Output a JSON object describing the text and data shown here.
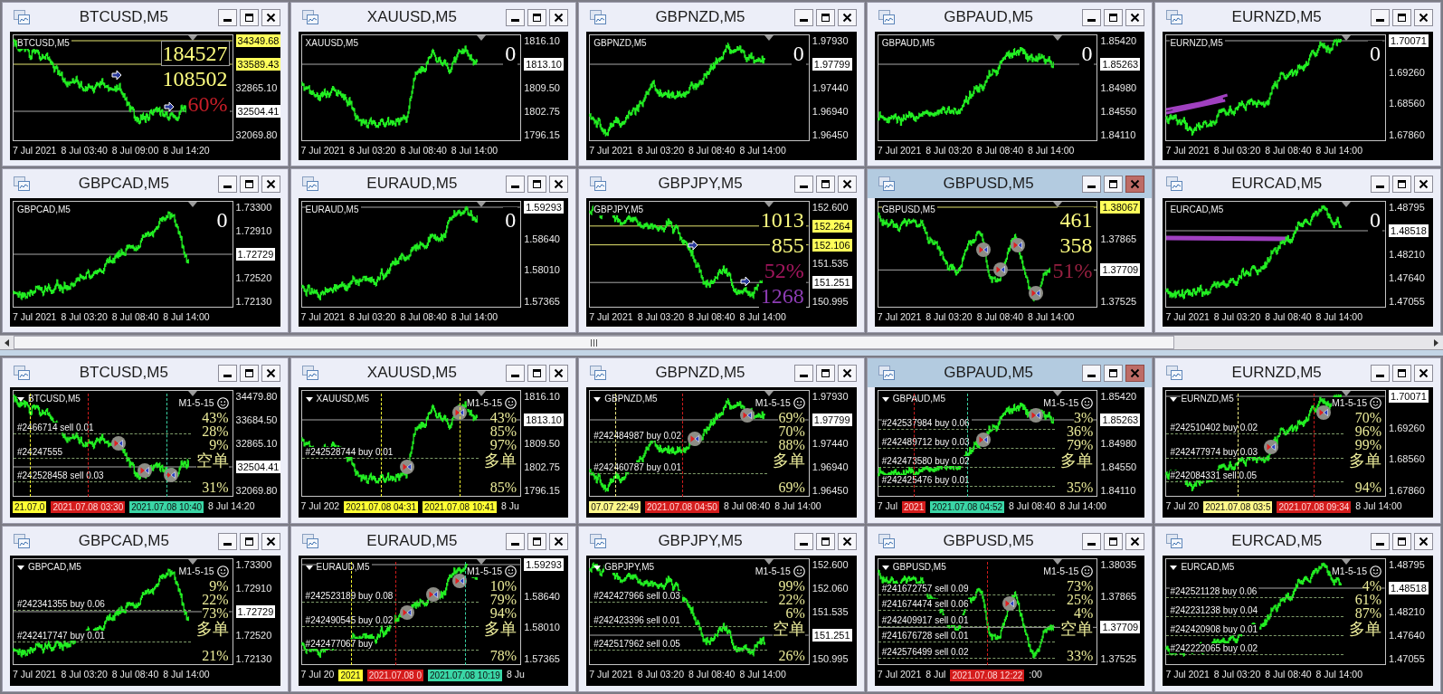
{
  "top_panel": {
    "windows": [
      {
        "title": "BTCUSD,M5",
        "selected": false,
        "chart": {
          "symbol": "BTCUSD,M5",
          "overlays": [
            {
              "text": "184527",
              "color": "#ffff80",
              "selected": true
            },
            {
              "text": "108502",
              "color": "#ffff80",
              "selected": false
            },
            {
              "text": "60%",
              "color": "#c81e28",
              "selected": false
            }
          ],
          "markers": [
            {
              "kind": "arrow"
            },
            {
              "kind": "arrow"
            }
          ],
          "price_axis": [
            {
              "text": "34349.68",
              "kind": "level"
            },
            {
              "text": "33589.43",
              "kind": "level"
            },
            {
              "text": "32865.10",
              "kind": "tick"
            },
            {
              "text": "32504.41",
              "kind": "bid"
            },
            {
              "text": "32069.80",
              "kind": "tick"
            }
          ],
          "time_axis": [
            {
              "text": "7 Jul 2021",
              "kind": "label"
            },
            {
              "text": "8 Jul 03:40",
              "kind": "label"
            },
            {
              "text": "8 Jul 09:00",
              "kind": "label"
            },
            {
              "text": "8 Jul 14:20",
              "kind": "label"
            }
          ]
        }
      },
      {
        "title": "XAUUSD,M5",
        "selected": false,
        "chart": {
          "symbol": "XAUUSD,M5",
          "overlays": [
            {
              "text": "0",
              "color": "#ffffff",
              "selected": false
            }
          ],
          "price_axis": [
            {
              "text": "1816.10",
              "kind": "tick"
            },
            {
              "text": "1813.10",
              "kind": "bid"
            },
            {
              "text": "1809.50",
              "kind": "tick"
            },
            {
              "text": "1802.75",
              "kind": "tick"
            },
            {
              "text": "1796.15",
              "kind": "tick"
            }
          ],
          "time_axis": [
            {
              "text": "7 Jul 2021",
              "kind": "label"
            },
            {
              "text": "8 Jul 03:20",
              "kind": "label"
            },
            {
              "text": "8 Jul 08:40",
              "kind": "label"
            },
            {
              "text": "8 Jul 14:00",
              "kind": "label"
            }
          ]
        }
      },
      {
        "title": "GBPNZD,M5",
        "selected": false,
        "chart": {
          "symbol": "GBPNZD,M5",
          "overlays": [
            {
              "text": "0",
              "color": "#ffffff",
              "selected": false
            }
          ],
          "price_axis": [
            {
              "text": "1.97930",
              "kind": "tick"
            },
            {
              "text": "1.97799",
              "kind": "bid"
            },
            {
              "text": "1.97440",
              "kind": "tick"
            },
            {
              "text": "1.96940",
              "kind": "tick"
            },
            {
              "text": "1.96450",
              "kind": "tick"
            }
          ],
          "time_axis": [
            {
              "text": "7 Jul 2021",
              "kind": "label"
            },
            {
              "text": "8 Jul 03:20",
              "kind": "label"
            },
            {
              "text": "8 Jul 08:40",
              "kind": "label"
            },
            {
              "text": "8 Jul 14:00",
              "kind": "label"
            }
          ]
        }
      },
      {
        "title": "GBPAUD,M5",
        "selected": false,
        "chart": {
          "symbol": "GBPAUD,M5",
          "overlays": [
            {
              "text": "0",
              "color": "#ffffff",
              "selected": false
            }
          ],
          "price_axis": [
            {
              "text": "1.85420",
              "kind": "tick"
            },
            {
              "text": "1.85263",
              "kind": "bid"
            },
            {
              "text": "1.84980",
              "kind": "tick"
            },
            {
              "text": "1.84550",
              "kind": "tick"
            },
            {
              "text": "1.84110",
              "kind": "tick"
            }
          ],
          "time_axis": [
            {
              "text": "7 Jul 2021",
              "kind": "label"
            },
            {
              "text": "8 Jul 03:20",
              "kind": "label"
            },
            {
              "text": "8 Jul 08:40",
              "kind": "label"
            },
            {
              "text": "8 Jul 14:00",
              "kind": "label"
            }
          ]
        }
      },
      {
        "title": "EURNZD,M5",
        "selected": false,
        "chart": {
          "symbol": "EURNZD,M5",
          "indicator_lines": [
            {
              "kind": "fan"
            }
          ],
          "overlays": [
            {
              "text": "0",
              "color": "#ffffff",
              "selected": false
            }
          ],
          "price_axis": [
            {
              "text": "1.70071",
              "kind": "bid"
            },
            {
              "text": "1.69260",
              "kind": "tick"
            },
            {
              "text": "1.68560",
              "kind": "tick"
            },
            {
              "text": "1.67860",
              "kind": "tick"
            }
          ],
          "time_axis": [
            {
              "text": "7 Jul 2021",
              "kind": "label"
            },
            {
              "text": "8 Jul 03:20",
              "kind": "label"
            },
            {
              "text": "8 Jul 08:40",
              "kind": "label"
            },
            {
              "text": "8 Jul 14:00",
              "kind": "label"
            }
          ]
        }
      },
      {
        "title": "GBPCAD,M5",
        "selected": false,
        "chart": {
          "symbol": "GBPCAD,M5",
          "overlays": [
            {
              "text": "0",
              "color": "#ffffff",
              "selected": false
            }
          ],
          "price_axis": [
            {
              "text": "1.73300",
              "kind": "tick"
            },
            {
              "text": "1.72910",
              "kind": "tick"
            },
            {
              "text": "1.72729",
              "kind": "bid"
            },
            {
              "text": "1.72520",
              "kind": "tick"
            },
            {
              "text": "1.72130",
              "kind": "tick"
            }
          ],
          "time_axis": [
            {
              "text": "7 Jul 2021",
              "kind": "label"
            },
            {
              "text": "8 Jul 03:20",
              "kind": "label"
            },
            {
              "text": "8 Jul 08:40",
              "kind": "label"
            },
            {
              "text": "8 Jul 14:00",
              "kind": "label"
            }
          ]
        }
      },
      {
        "title": "EURAUD,M5",
        "selected": false,
        "chart": {
          "symbol": "EURAUD,M5",
          "overlays": [
            {
              "text": "0",
              "color": "#ffffff",
              "selected": false
            }
          ],
          "price_axis": [
            {
              "text": "1.59293",
              "kind": "bid"
            },
            {
              "text": "1.58640",
              "kind": "tick"
            },
            {
              "text": "1.58010",
              "kind": "tick"
            },
            {
              "text": "1.57365",
              "kind": "tick"
            }
          ],
          "time_axis": [
            {
              "text": "7 Jul 2021",
              "kind": "label"
            },
            {
              "text": "8 Jul 03:20",
              "kind": "label"
            },
            {
              "text": "8 Jul 08:40",
              "kind": "label"
            },
            {
              "text": "8 Jul 14:00",
              "kind": "label"
            }
          ]
        }
      },
      {
        "title": "GBPJPY,M5",
        "selected": false,
        "chart": {
          "symbol": "GBPJPY,M5",
          "overlays": [
            {
              "text": "1013",
              "color": "#ffff80",
              "selected": false
            },
            {
              "text": "855",
              "color": "#ffff80",
              "selected": false
            },
            {
              "text": "52%",
              "color": "#a3165e",
              "selected": false
            },
            {
              "text": "1268",
              "color": "#8d3cb4",
              "selected": false
            }
          ],
          "markers": [
            {
              "kind": "arrow"
            },
            {
              "kind": "arrow"
            }
          ],
          "price_axis": [
            {
              "text": "152.600",
              "kind": "tick"
            },
            {
              "text": "152.264",
              "kind": "level"
            },
            {
              "text": "152.106",
              "kind": "level"
            },
            {
              "text": "151.535",
              "kind": "tick"
            },
            {
              "text": "151.251",
              "kind": "bid"
            },
            {
              "text": "150.995",
              "kind": "tick"
            }
          ],
          "time_axis": [
            {
              "text": "7 Jul 2021",
              "kind": "label"
            },
            {
              "text": "8 Jul 03:20",
              "kind": "label"
            },
            {
              "text": "8 Jul 08:40",
              "kind": "label"
            },
            {
              "text": "8 Jul 14:00",
              "kind": "label"
            }
          ]
        }
      },
      {
        "title": "GBPUSD,M5",
        "selected": true,
        "chart": {
          "symbol": "GBPUSD,M5",
          "overlays": [
            {
              "text": "461",
              "color": "#ffff80",
              "selected": false
            },
            {
              "text": "358",
              "color": "#ffff80",
              "selected": false
            },
            {
              "text": "51%",
              "color": "#962040",
              "selected": false
            }
          ],
          "markers": [
            {
              "kind": "circle"
            },
            {
              "kind": "circle"
            },
            {
              "kind": "circle"
            },
            {
              "kind": "circle"
            }
          ],
          "price_axis": [
            {
              "text": "1.38067",
              "kind": "level"
            },
            {
              "text": "1.37865",
              "kind": "tick"
            },
            {
              "text": "1.37709",
              "kind": "bid"
            },
            {
              "text": "1.37525",
              "kind": "tick"
            }
          ],
          "time_axis": [
            {
              "text": "7 Jul 2021",
              "kind": "label"
            },
            {
              "text": "8 Jul 03:20",
              "kind": "label"
            },
            {
              "text": "8 Jul 08:40",
              "kind": "label"
            },
            {
              "text": "8 Jul 14:00",
              "kind": "label"
            }
          ]
        }
      },
      {
        "title": "EURCAD,M5",
        "selected": false,
        "chart": {
          "symbol": "EURCAD,M5",
          "indicator_lines": [
            {
              "kind": "band"
            }
          ],
          "overlays": [
            {
              "text": "0",
              "color": "#ffffff",
              "selected": false
            }
          ],
          "price_axis": [
            {
              "text": "1.48795",
              "kind": "tick"
            },
            {
              "text": "1.48518",
              "kind": "bid"
            },
            {
              "text": "1.48210",
              "kind": "tick"
            },
            {
              "text": "1.47640",
              "kind": "tick"
            },
            {
              "text": "1.47055",
              "kind": "tick"
            }
          ],
          "time_axis": [
            {
              "text": "7 Jul 2021",
              "kind": "label"
            },
            {
              "text": "8 Jul 03:20",
              "kind": "label"
            },
            {
              "text": "8 Jul 08:40",
              "kind": "label"
            },
            {
              "text": "8 Jul 14:00",
              "kind": "label"
            }
          ]
        }
      }
    ]
  },
  "bottom_panel": {
    "windows": [
      {
        "title": "BTCUSD,M5",
        "selected": false,
        "chart": {
          "symbol": "BTCUSD,M5",
          "indicator": "M1-5-15",
          "orders": [
            "#2466714 sell 0.01",
            "#24247555",
            "#242528458 sell 0.03"
          ],
          "stats": [
            {
              "text": "43%",
              "kind": "percent"
            },
            {
              "text": "28%",
              "kind": "percent"
            },
            {
              "text": "9%",
              "kind": "percent"
            },
            {
              "text": "空单",
              "kind": "direction"
            },
            {
              "text": "31%",
              "kind": "percent"
            }
          ],
          "markers": [
            {
              "kind": "circle"
            },
            {
              "kind": "circle"
            },
            {
              "kind": "circle"
            }
          ],
          "price_axis": [
            {
              "text": "34479.80",
              "kind": "tick"
            },
            {
              "text": "33684.50",
              "kind": "tick"
            },
            {
              "text": "32865.10",
              "kind": "tick"
            },
            {
              "text": "32504.41",
              "kind": "bid"
            },
            {
              "text": "32069.80",
              "kind": "tick"
            }
          ],
          "time_axis": [
            {
              "text": "21.07.0",
              "kind": "badge",
              "color": "#ffff33"
            },
            {
              "text": "2021.07.08 03:30",
              "kind": "badge",
              "color": "#d41c1c"
            },
            {
              "text": "2021.07.08 10:40",
              "kind": "badge",
              "color": "#3ad6a6"
            },
            {
              "text": "8 Jul 14:20",
              "kind": "label"
            }
          ]
        }
      },
      {
        "title": "XAUUSD,M5",
        "selected": false,
        "chart": {
          "symbol": "XAUUSD,M5",
          "indicator": "M1-5-15",
          "orders": [
            "#242528744 buy 0.01"
          ],
          "stats": [
            {
              "text": "43%",
              "kind": "percent"
            },
            {
              "text": "85%",
              "kind": "percent"
            },
            {
              "text": "97%",
              "kind": "percent"
            },
            {
              "text": "多单",
              "kind": "direction"
            },
            {
              "text": "85%",
              "kind": "percent"
            }
          ],
          "markers": [
            {
              "kind": "circle"
            },
            {
              "kind": "circle"
            }
          ],
          "price_axis": [
            {
              "text": "1816.10",
              "kind": "tick"
            },
            {
              "text": "1813.10",
              "kind": "bid"
            },
            {
              "text": "1809.50",
              "kind": "tick"
            },
            {
              "text": "1802.75",
              "kind": "tick"
            },
            {
              "text": "1796.15",
              "kind": "tick"
            }
          ],
          "time_axis": [
            {
              "text": "7 Jul 202",
              "kind": "label"
            },
            {
              "text": "2021.07.08 04:31",
              "kind": "badge",
              "color": "#ffff33"
            },
            {
              "text": "2021.07.08 10:41",
              "kind": "badge",
              "color": "#ffff33"
            },
            {
              "text": "8 Ju",
              "kind": "label"
            }
          ]
        }
      },
      {
        "title": "GBPNZD,M5",
        "selected": false,
        "chart": {
          "symbol": "GBPNZD,M5",
          "indicator": "M1-5-15",
          "orders": [
            "#242484987 buy 0.02",
            "#242460787 buy 0.01"
          ],
          "stats": [
            {
              "text": "69%",
              "kind": "percent"
            },
            {
              "text": "70%",
              "kind": "percent"
            },
            {
              "text": "88%",
              "kind": "percent"
            },
            {
              "text": "多单",
              "kind": "direction"
            },
            {
              "text": "69%",
              "kind": "percent"
            }
          ],
          "markers": [
            {
              "kind": "circle"
            },
            {
              "kind": "circle"
            }
          ],
          "price_axis": [
            {
              "text": "1.97930",
              "kind": "tick"
            },
            {
              "text": "1.97799",
              "kind": "bid"
            },
            {
              "text": "1.97440",
              "kind": "tick"
            },
            {
              "text": "1.96940",
              "kind": "tick"
            },
            {
              "text": "1.96450",
              "kind": "tick"
            }
          ],
          "time_axis": [
            {
              "text": "07.07 22:49",
              "kind": "badge",
              "color": "#fff88a"
            },
            {
              "text": "2021.07.08 04:50",
              "kind": "badge",
              "color": "#d41c1c"
            },
            {
              "text": "8 Jul 08:40",
              "kind": "label"
            },
            {
              "text": "8 Jul 14:00",
              "kind": "label"
            }
          ]
        }
      },
      {
        "title": "GBPAUD,M5",
        "selected": true,
        "chart": {
          "symbol": "GBPAUD,M5",
          "indicator": "M1-5-15",
          "orders": [
            "#242537984 buy 0.06",
            "#242489712 buy 0.03",
            "#242473580 buy 0.02",
            "#242425476 buy 0.01"
          ],
          "stats": [
            {
              "text": "3%",
              "kind": "percent"
            },
            {
              "text": "36%",
              "kind": "percent"
            },
            {
              "text": "79%",
              "kind": "percent"
            },
            {
              "text": "多单",
              "kind": "direction"
            },
            {
              "text": "35%",
              "kind": "percent"
            }
          ],
          "markers": [
            {
              "kind": "circle"
            },
            {
              "kind": "circle"
            }
          ],
          "price_axis": [
            {
              "text": "1.85420",
              "kind": "tick"
            },
            {
              "text": "1.85263",
              "kind": "bid"
            },
            {
              "text": "1.84980",
              "kind": "tick"
            },
            {
              "text": "1.84550",
              "kind": "tick"
            },
            {
              "text": "1.84110",
              "kind": "tick"
            }
          ],
          "time_axis": [
            {
              "text": "7 Jul",
              "kind": "label"
            },
            {
              "text": "2021",
              "kind": "badge",
              "color": "#d41c1c"
            },
            {
              "text": "2021.07.08 04:52",
              "kind": "badge",
              "color": "#3ad6a6"
            },
            {
              "text": "8 Jul 08:40",
              "kind": "label"
            },
            {
              "text": "8 Jul 14:00",
              "kind": "label"
            }
          ]
        }
      },
      {
        "title": "EURNZD,M5",
        "selected": false,
        "chart": {
          "symbol": "EURNZD,M5",
          "indicator": "M1-5-15",
          "orders": [
            "#242510402 buy 0.02",
            "#242477974 buy 0.03",
            "#242084331 sell 0.05"
          ],
          "stats": [
            {
              "text": "70%",
              "kind": "percent"
            },
            {
              "text": "96%",
              "kind": "percent"
            },
            {
              "text": "99%",
              "kind": "percent"
            },
            {
              "text": "多单",
              "kind": "direction"
            },
            {
              "text": "94%",
              "kind": "percent"
            }
          ],
          "markers": [
            {
              "kind": "circle"
            },
            {
              "kind": "circle"
            }
          ],
          "price_axis": [
            {
              "text": "1.70071",
              "kind": "bid"
            },
            {
              "text": "1.69260",
              "kind": "tick"
            },
            {
              "text": "1.68560",
              "kind": "tick"
            },
            {
              "text": "1.67860",
              "kind": "tick"
            }
          ],
          "time_axis": [
            {
              "text": "7 Jul 20",
              "kind": "label"
            },
            {
              "text": "2021.07.08 03:5",
              "kind": "badge",
              "color": "#fff88a"
            },
            {
              "text": "2021.07.08 09:34",
              "kind": "badge",
              "color": "#d41c1c"
            },
            {
              "text": "8 Jul 14:00",
              "kind": "label"
            }
          ]
        }
      },
      {
        "title": "GBPCAD,M5",
        "selected": false,
        "chart": {
          "symbol": "GBPCAD,M5",
          "indicator": "M1-5-15",
          "orders": [
            "#242341355 buy 0.06",
            "#242417747 buy 0.01"
          ],
          "stats": [
            {
              "text": "9%",
              "kind": "percent"
            },
            {
              "text": "22%",
              "kind": "percent"
            },
            {
              "text": "73%",
              "kind": "percent"
            },
            {
              "text": "多单",
              "kind": "direction"
            },
            {
              "text": "21%",
              "kind": "percent"
            }
          ],
          "price_axis": [
            {
              "text": "1.73300",
              "kind": "tick"
            },
            {
              "text": "1.72910",
              "kind": "tick"
            },
            {
              "text": "1.72729",
              "kind": "bid"
            },
            {
              "text": "1.72520",
              "kind": "tick"
            },
            {
              "text": "1.72130",
              "kind": "tick"
            }
          ],
          "time_axis": [
            {
              "text": "7 Jul 2021",
              "kind": "label"
            },
            {
              "text": "8 Jul 03:20",
              "kind": "label"
            },
            {
              "text": "8 Jul 08:40",
              "kind": "label"
            },
            {
              "text": "8 Jul 14:00",
              "kind": "label"
            }
          ]
        }
      },
      {
        "title": "EURAUD,M5",
        "selected": false,
        "chart": {
          "symbol": "EURAUD,M5",
          "indicator": "M1-5-15",
          "orders": [
            "#242523189 buy 0.08",
            "#242490545 buy 0.02",
            "#242477067 buy"
          ],
          "stats": [
            {
              "text": "10%",
              "kind": "percent"
            },
            {
              "text": "79%",
              "kind": "percent"
            },
            {
              "text": "94%",
              "kind": "percent"
            },
            {
              "text": "多单",
              "kind": "direction"
            },
            {
              "text": "78%",
              "kind": "percent"
            }
          ],
          "markers": [
            {
              "kind": "circle"
            },
            {
              "kind": "circle"
            },
            {
              "kind": "circle"
            }
          ],
          "price_axis": [
            {
              "text": "1.59293",
              "kind": "bid"
            },
            {
              "text": "1.58640",
              "kind": "tick"
            },
            {
              "text": "1.58010",
              "kind": "tick"
            },
            {
              "text": "1.57365",
              "kind": "tick"
            }
          ],
          "time_axis": [
            {
              "text": "7 Jul 20",
              "kind": "label"
            },
            {
              "text": "2021",
              "kind": "badge",
              "color": "#ffff33"
            },
            {
              "text": "2021.07.08 0",
              "kind": "badge",
              "color": "#d41c1c"
            },
            {
              "text": "2021.07.08 10:19",
              "kind": "badge",
              "color": "#3ad6a6"
            },
            {
              "text": "8 Ju",
              "kind": "label"
            }
          ]
        }
      },
      {
        "title": "GBPJPY,M5",
        "selected": false,
        "chart": {
          "symbol": "GBPJPY,M5",
          "indicator": "M1-5-15",
          "orders": [
            "#242427966 sell 0.03",
            "#242423396 sell 0.01",
            "#242517962 sell 0.05"
          ],
          "stats": [
            {
              "text": "99%",
              "kind": "percent"
            },
            {
              "text": "22%",
              "kind": "percent"
            },
            {
              "text": "6%",
              "kind": "percent"
            },
            {
              "text": "空单",
              "kind": "direction"
            },
            {
              "text": "26%",
              "kind": "percent"
            }
          ],
          "price_axis": [
            {
              "text": "152.600",
              "kind": "tick"
            },
            {
              "text": "152.060",
              "kind": "tick"
            },
            {
              "text": "151.535",
              "kind": "tick"
            },
            {
              "text": "151.251",
              "kind": "bid"
            },
            {
              "text": "150.995",
              "kind": "tick"
            }
          ],
          "time_axis": [
            {
              "text": "7 Jul 2021",
              "kind": "label"
            },
            {
              "text": "8 Jul 03:20",
              "kind": "label"
            },
            {
              "text": "8 Jul 08:40",
              "kind": "label"
            },
            {
              "text": "8 Jul 14:00",
              "kind": "label"
            }
          ]
        }
      },
      {
        "title": "GBPUSD,M5",
        "selected": false,
        "chart": {
          "symbol": "GBPUSD,M5",
          "indicator": "M1-5-15",
          "orders": [
            "#241672757 sell 0.09",
            "#241674474 sell 0.06",
            "#242409917 sell 0.01",
            "#241676728 sell 0.01",
            "#242576499 sell 0.02"
          ],
          "stats": [
            {
              "text": "73%",
              "kind": "percent"
            },
            {
              "text": "25%",
              "kind": "percent"
            },
            {
              "text": "4%",
              "kind": "percent"
            },
            {
              "text": "空单",
              "kind": "direction"
            },
            {
              "text": "33%",
              "kind": "percent"
            }
          ],
          "markers": [
            {
              "kind": "circle"
            }
          ],
          "price_axis": [
            {
              "text": "1.38035",
              "kind": "tick"
            },
            {
              "text": "1.37865",
              "kind": "tick"
            },
            {
              "text": "1.37709",
              "kind": "bid"
            },
            {
              "text": "1.37525",
              "kind": "tick"
            }
          ],
          "time_axis": [
            {
              "text": "7 Jul 2021",
              "kind": "label"
            },
            {
              "text": "8 Jul",
              "kind": "label"
            },
            {
              "text": "2021.07.08 12:22",
              "kind": "badge",
              "color": "#d41c1c"
            },
            {
              "text": ":00",
              "kind": "label"
            }
          ]
        }
      },
      {
        "title": "EURCAD,M5",
        "selected": false,
        "chart": {
          "symbol": "EURCAD,M5",
          "indicator": "M1-5-15",
          "orders": [
            "#242521128 buy 0.06",
            "#242231238 buy 0.04",
            "#242420908 buy 0.01",
            "#242222065 buy 0.02"
          ],
          "stats": [
            {
              "text": "4%",
              "kind": "percent"
            },
            {
              "text": "61%",
              "kind": "percent"
            },
            {
              "text": "87%",
              "kind": "percent"
            },
            {
              "text": "多单",
              "kind": "direction"
            }
          ],
          "price_axis": [
            {
              "text": "1.48795",
              "kind": "tick"
            },
            {
              "text": "1.48518",
              "kind": "bid"
            },
            {
              "text": "1.48210",
              "kind": "tick"
            },
            {
              "text": "1.47640",
              "kind": "tick"
            },
            {
              "text": "1.47055",
              "kind": "tick"
            }
          ],
          "time_axis": [
            {
              "text": "7 Jul 2021",
              "kind": "label"
            },
            {
              "text": "8 Jul 03:20",
              "kind": "label"
            },
            {
              "text": "8 Jul 08:40",
              "kind": "label"
            },
            {
              "text": "8 Jul 14:00",
              "kind": "label"
            }
          ]
        }
      }
    ]
  }
}
